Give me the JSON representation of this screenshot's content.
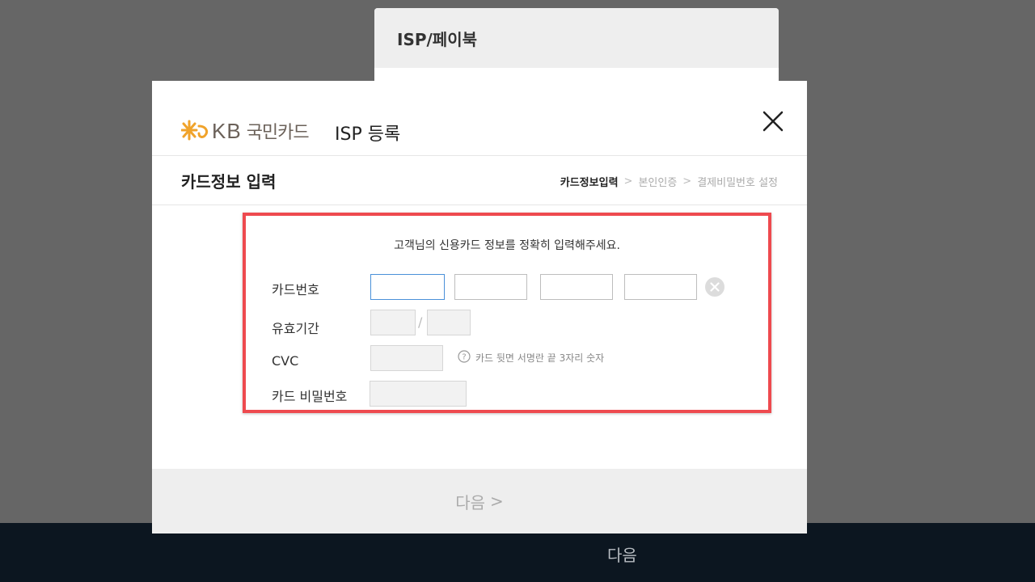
{
  "background_panel": {
    "title": "ISP/페이북"
  },
  "bottom_bar": {
    "next_label": "다음"
  },
  "modal": {
    "brand": {
      "kb": "KB",
      "name": "국민카드"
    },
    "title": "ISP 등록",
    "step_title": "카드정보 입력",
    "breadcrumb": [
      "카드정보입력",
      "본인인증",
      "결제비밀번호 설정"
    ],
    "breadcrumb_sep": ">",
    "form": {
      "intro": "고객님의 신용카드 정보를 정확히 입력해주세요.",
      "card_number_label": "카드번호",
      "card_number_values": [
        "",
        "",
        "",
        ""
      ],
      "expiry_label": "유효기간",
      "expiry_separator": "/",
      "expiry_month": "",
      "expiry_year": "",
      "cvc_label": "CVC",
      "cvc_value": "",
      "cvc_help": "카드 뒷면 서명란 끝 3자리 숫자",
      "password_label": "카드 비밀번호",
      "password_value": ""
    },
    "footer": {
      "next_label": "다음",
      "next_chevron": ">"
    }
  },
  "colors": {
    "overlay": "#666666",
    "highlight_border": "#ee4a4f",
    "brand_star": "#f0a32b",
    "brand_text": "#6b6159",
    "active_field_border": "#4a90d9"
  }
}
